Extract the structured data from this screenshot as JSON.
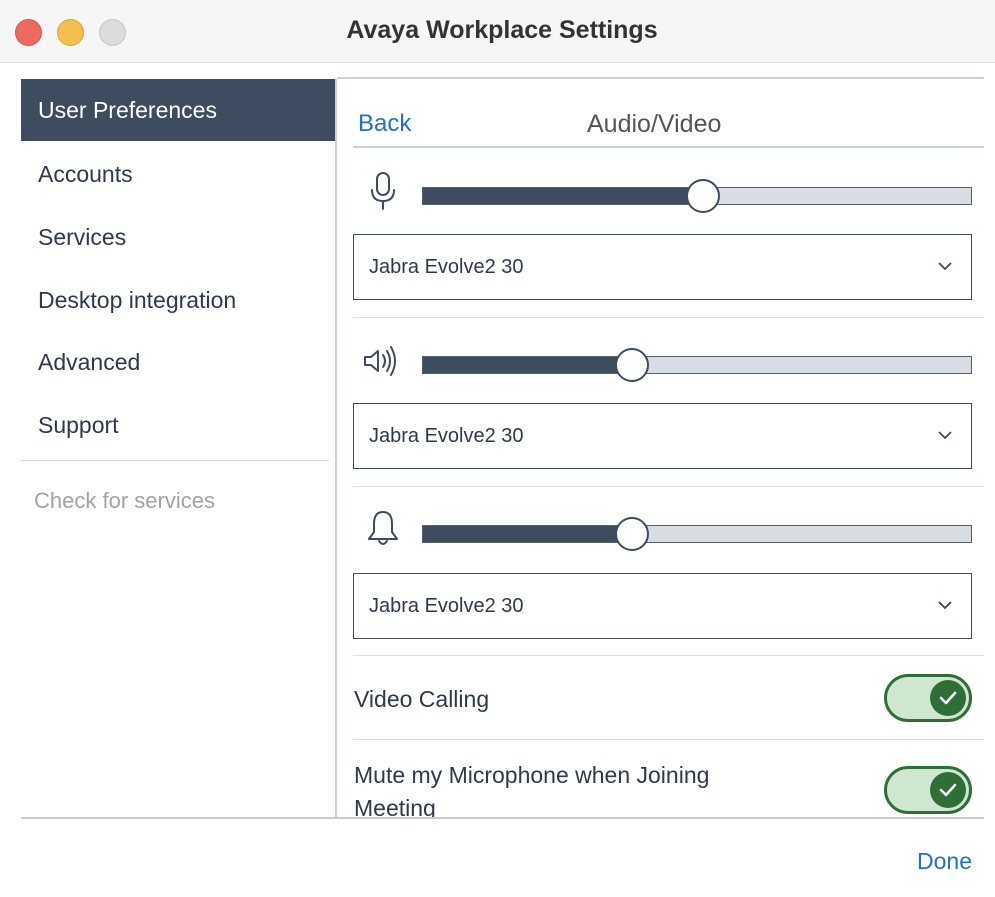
{
  "window": {
    "title": "Avaya Workplace Settings"
  },
  "sidebar": {
    "items": [
      {
        "label": "User Preferences",
        "active": true
      },
      {
        "label": "Accounts"
      },
      {
        "label": "Services"
      },
      {
        "label": "Desktop integration"
      },
      {
        "label": "Advanced"
      },
      {
        "label": "Support"
      }
    ],
    "check_services": "Check for services"
  },
  "header": {
    "back_label": "Back",
    "title": "Audio/Video"
  },
  "audio": {
    "microphone": {
      "icon": "microphone-icon",
      "level_percent": 51,
      "device": "Jabra Evolve2 30"
    },
    "speaker": {
      "icon": "speaker-icon",
      "level_percent": 38,
      "device": "Jabra Evolve2 30"
    },
    "ringer": {
      "icon": "bell-icon",
      "level_percent": 38,
      "device": "Jabra Evolve2 30"
    }
  },
  "toggles": {
    "video_calling": {
      "label": "Video Calling",
      "on": true
    },
    "mute_on_join": {
      "label": "Mute my Microphone when Joining Meeting",
      "on": true
    }
  },
  "footer": {
    "done_label": "Done"
  },
  "colors": {
    "accent": "#1f6fd6",
    "sidebar_active": "#3d4c5f",
    "toggle_on": "#2f6e36"
  }
}
